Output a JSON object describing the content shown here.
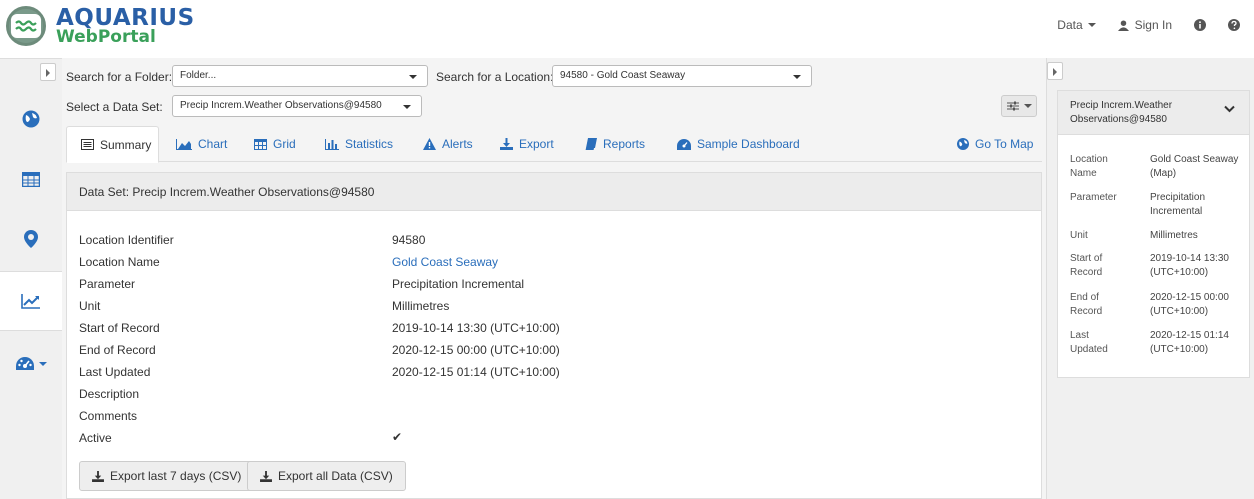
{
  "header": {
    "logo_line1": "AQUARIUS",
    "logo_line2": "WebPortal",
    "data_menu": "Data",
    "sign_in": "Sign In"
  },
  "filters": {
    "folder_label": "Search for a Folder:",
    "folder_placeholder": "Folder...",
    "location_label": "Search for a Location:",
    "location_value": "94580 - Gold Coast Seaway",
    "dataset_label": "Select a Data Set:",
    "dataset_value": "Precip Increm.Weather Observations@94580"
  },
  "tabs": [
    {
      "label": "Summary"
    },
    {
      "label": "Chart"
    },
    {
      "label": "Grid"
    },
    {
      "label": "Statistics"
    },
    {
      "label": "Alerts"
    },
    {
      "label": "Export"
    },
    {
      "label": "Reports"
    },
    {
      "label": "Sample Dashboard"
    },
    {
      "label": "Go To Map"
    }
  ],
  "summary": {
    "heading": "Data Set: Precip Increm.Weather Observations@94580",
    "rows": [
      {
        "label": "Location Identifier",
        "value": "94580"
      },
      {
        "label": "Location Name",
        "value": "Gold Coast Seaway"
      },
      {
        "label": "Parameter",
        "value": "Precipitation Incremental"
      },
      {
        "label": "Unit",
        "value": "Millimetres"
      },
      {
        "label": "Start of Record",
        "value": "2019-10-14 13:30 (UTC+10:00)"
      },
      {
        "label": "End of Record",
        "value": "2020-12-15 00:00 (UTC+10:00)"
      },
      {
        "label": "Last Updated",
        "value": "2020-12-15 01:14 (UTC+10:00)"
      },
      {
        "label": "Description",
        "value": ""
      },
      {
        "label": "Comments",
        "value": ""
      },
      {
        "label": "Active",
        "value": "✔"
      }
    ],
    "export_7days": "Export last 7 days (CSV)",
    "export_all": "Export all Data (CSV)"
  },
  "side": {
    "title": "Precip Increm.Weather Observations@94580",
    "rows": [
      {
        "label": "Location Name",
        "value": "Gold Coast Seaway (Map)"
      },
      {
        "label": "Parameter",
        "value": "Precipitation Incremental"
      },
      {
        "label": "Unit",
        "value": "Millimetres"
      },
      {
        "label": "Start of Record",
        "value": "2019-10-14 13:30 (UTC+10:00)"
      },
      {
        "label": "End of Record",
        "value": "2020-12-15 00:00 (UTC+10:00)"
      },
      {
        "label": "Last Updated",
        "value": "2020-12-15 01:14 (UTC+10:00)"
      }
    ]
  },
  "colors": {
    "link": "#2a6ebb",
    "logo_blue": "#2a5fa6",
    "logo_green": "#3aa05a"
  }
}
